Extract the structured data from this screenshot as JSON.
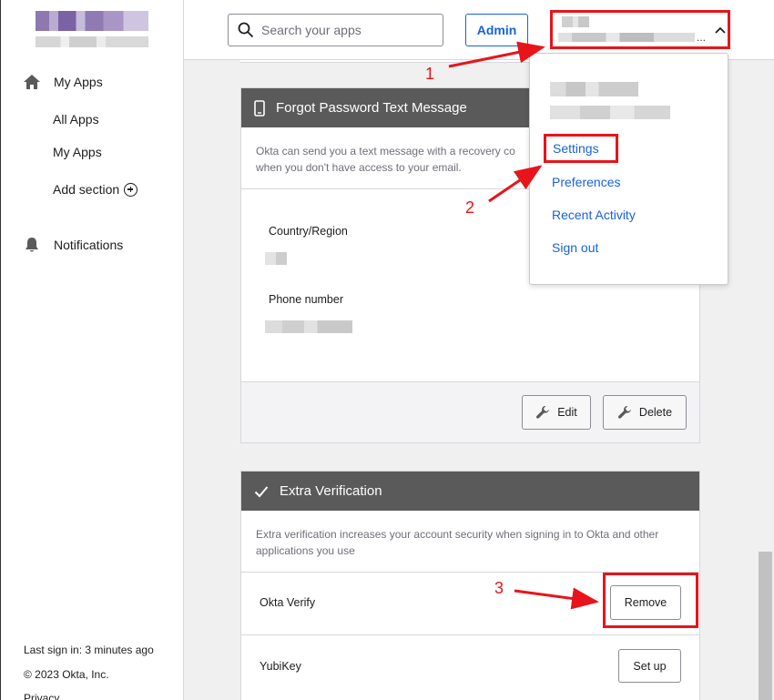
{
  "sidebar": {
    "my_apps": "My Apps",
    "sub_items": [
      "All Apps",
      "My Apps"
    ],
    "add_section": "Add section",
    "notifications": "Notifications",
    "footer": {
      "last_sign_in": "Last sign in: 3 minutes ago",
      "copyright": "© 2023 Okta, Inc.",
      "privacy": "Privacy"
    }
  },
  "header": {
    "search_placeholder": "Search your apps",
    "admin_label": "Admin",
    "user_menu_ellipsis": "..."
  },
  "dropdown": {
    "items": [
      "Settings",
      "Preferences",
      "Recent Activity",
      "Sign out"
    ]
  },
  "sms_card": {
    "title": "Forgot Password Text Message",
    "description": "Okta can send you a text message with a recovery co",
    "description2": "when you don't have access to your email.",
    "country_label": "Country/Region",
    "phone_label": "Phone number",
    "edit_label": "Edit",
    "delete_label": "Delete"
  },
  "ev_card": {
    "title": "Extra Verification",
    "description": "Extra verification increases your account security when signing in to Okta and other",
    "description2": "applications you use",
    "rows": [
      {
        "name": "Okta Verify",
        "action": "Remove"
      },
      {
        "name": "YubiKey",
        "action": "Set up"
      }
    ]
  },
  "annotations": {
    "step1": "1",
    "step2": "2",
    "step3": "3"
  },
  "colors": {
    "accent": "#1662dd",
    "annotation": "#e8141b",
    "card_header": "#5a5a5a"
  }
}
